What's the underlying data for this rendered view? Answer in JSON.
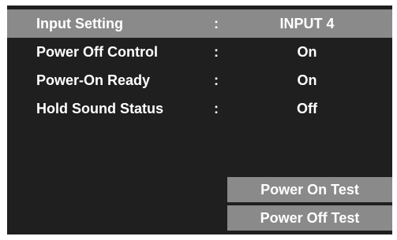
{
  "menu": {
    "rows": [
      {
        "label": "Input Setting",
        "separator": ":",
        "value": "INPUT 4",
        "selected": true
      },
      {
        "label": "Power Off Control",
        "separator": ":",
        "value": "On",
        "selected": false
      },
      {
        "label": "Power-On Ready",
        "separator": ":",
        "value": "On",
        "selected": false
      },
      {
        "label": "Hold Sound Status",
        "separator": ":",
        "value": "Off",
        "selected": false
      }
    ],
    "buttons": {
      "power_on_test": "Power On Test",
      "power_off_test": "Power Off Test"
    }
  },
  "colors": {
    "panel_background": "#1f1f1f",
    "highlight": "#8a8a8a",
    "text": "#ffffff"
  }
}
